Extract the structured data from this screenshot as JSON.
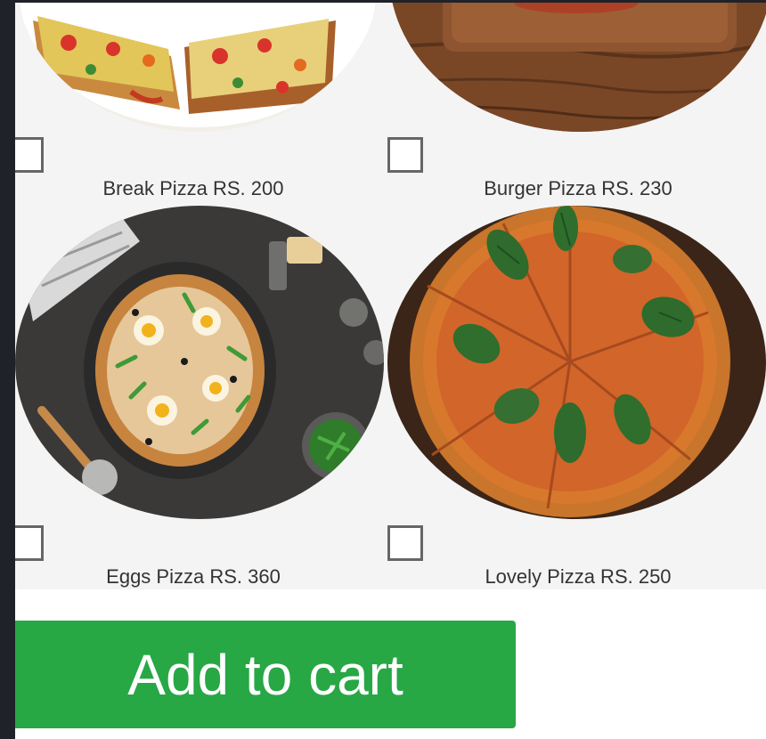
{
  "products": [
    {
      "label": "Break Pizza RS. 200",
      "icon": "bread-pizza-image"
    },
    {
      "label": "Burger Pizza RS. 230",
      "icon": "wooden-board-image"
    },
    {
      "label": "Eggs Pizza RS. 360",
      "icon": "eggs-pizza-image"
    },
    {
      "label": "Lovely Pizza RS. 250",
      "icon": "margherita-pizza-image"
    }
  ],
  "cart": {
    "label": "Add to cart"
  },
  "colors": {
    "accent": "#28a745",
    "frame": "#1f2229",
    "grid_background": "#f4f4f4",
    "checkbox_border": "#666666"
  }
}
